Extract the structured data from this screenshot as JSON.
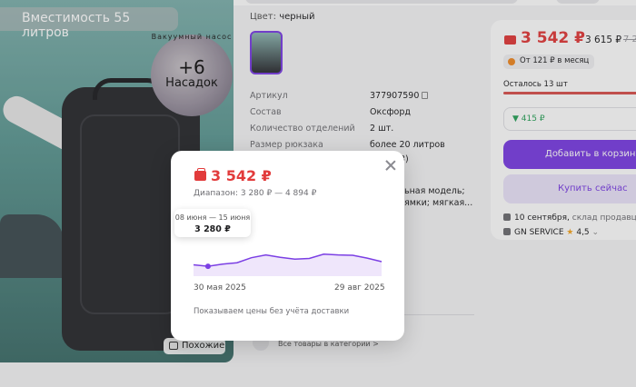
{
  "product": {
    "banner": "Вместимость 55 литров",
    "badge_arc": "Вакуумный насос",
    "badge_big": "+6",
    "badge_small": "Насадок",
    "similar": "Похожие"
  },
  "details": {
    "color_label": "Цвет:",
    "color_value": "черный",
    "specs": [
      {
        "k": "Артикул",
        "v": "377907590"
      },
      {
        "k": "Состав",
        "v": "Оксфорд"
      },
      {
        "k": "Количество отделений",
        "v": "2 шт."
      },
      {
        "k": "Размер рюкзака",
        "v": "более 20 литров"
      }
    ],
    "spec_extra_1": "3)",
    "spec_extra_2": "ьная модель;",
    "spec_extra_3": "ямки; мягкая...",
    "all_categories": "Все товары в категории >"
  },
  "buy": {
    "price": "3 542 ₽",
    "price2": "3 615 ₽",
    "old_price": "7 20",
    "monthly": "От 121 ₽ в месяц",
    "stock_left": "Осталось 13 шт",
    "stock_fraction": 0.96,
    "bonus": "▼ 415 ₽",
    "add_to_cart": "Добавить в корзину",
    "buy_now": "Купить сейчас",
    "delivery_date": "10 сентября,",
    "delivery_place": "склад продавца",
    "seller": "GN SERVICE",
    "rating": "4,5"
  },
  "popup": {
    "price": "3 542 ₽",
    "range": "Диапазон: 3 280 ₽ — 4 894 ₽",
    "tooltip_dates": "08 июня — 15 июня",
    "tooltip_price": "3 280 ₽",
    "date_start": "30 мая 2025",
    "date_end": "29 авг 2025",
    "note": "Показываем цены без учёта доставки"
  },
  "chart_data": {
    "type": "area",
    "x_start": "30 мая 2025",
    "x_end": "29 авг 2025",
    "ylim": [
      3000,
      5000
    ],
    "values": [
      3320,
      3280,
      3340,
      3380,
      3520,
      3600,
      3530,
      3480,
      3500,
      3620,
      3600,
      3590,
      3510,
      3410
    ],
    "highlight_index": 1,
    "colors": {
      "line": "#7b3fe4",
      "fill": "#efe6fb"
    }
  }
}
